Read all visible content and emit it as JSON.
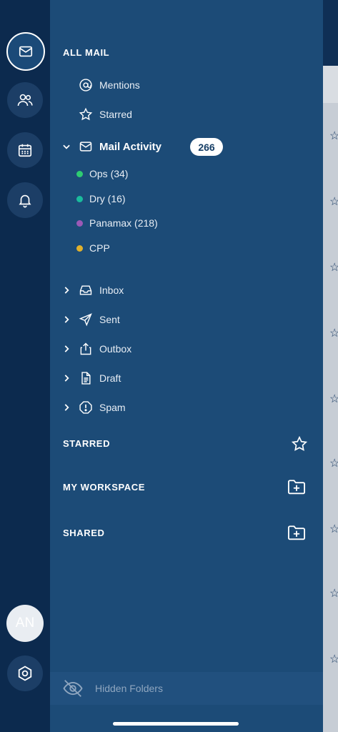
{
  "rail": {
    "avatar_initials": "AN"
  },
  "drawer": {
    "all_mail_header": "ALL MAIL",
    "mentions": "Mentions",
    "starred_item": "Starred",
    "mail_activity": "Mail Activity",
    "mail_activity_count": "266",
    "labels": [
      {
        "text": "Ops (34)",
        "color": "#2ecc71"
      },
      {
        "text": "Dry (16)",
        "color": "#1abc9c"
      },
      {
        "text": "Panamax (218)",
        "color": "#9b59b6"
      },
      {
        "text": "CPP",
        "color": "#e1b12c"
      }
    ],
    "folders": [
      "Inbox",
      "Sent",
      "Outbox",
      "Draft",
      "Spam"
    ],
    "starred_header": "STARRED",
    "workspace_header": "MY WORKSPACE",
    "shared_header": "SHARED",
    "hidden_folders": "Hidden Folders"
  }
}
